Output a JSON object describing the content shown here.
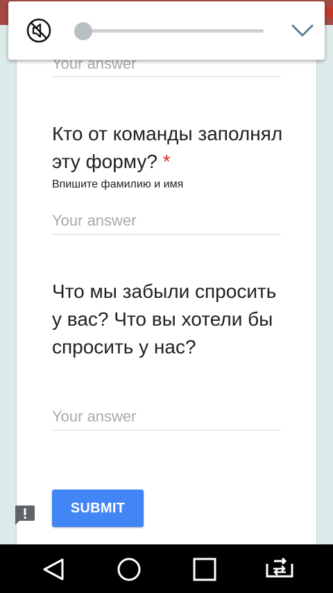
{
  "volume_panel": {
    "icons": {
      "mute": "volume-muted-icon",
      "collapse": "chevron-down-icon"
    },
    "level": 0
  },
  "form": {
    "previous_answer_placeholder": "Your answer",
    "questions": [
      {
        "title": "Кто от команды заполнял эту форму?",
        "required_mark": "*",
        "help": "Впишите фамилию и имя",
        "placeholder": "Your answer"
      },
      {
        "title": "Что мы забыли спросить у вас? Что вы хотели бы спросить у нас?",
        "placeholder": "Your answer"
      }
    ],
    "submit_label": "SUBMIT",
    "feedback_icon": "report-feedback-icon",
    "colors": {
      "accent": "#4285f4",
      "required": "#d93025",
      "background": "#dcebea"
    }
  },
  "nav_bar": {
    "icons": [
      "back-icon",
      "home-icon",
      "recents-icon",
      "screen-rotate-icon"
    ]
  }
}
